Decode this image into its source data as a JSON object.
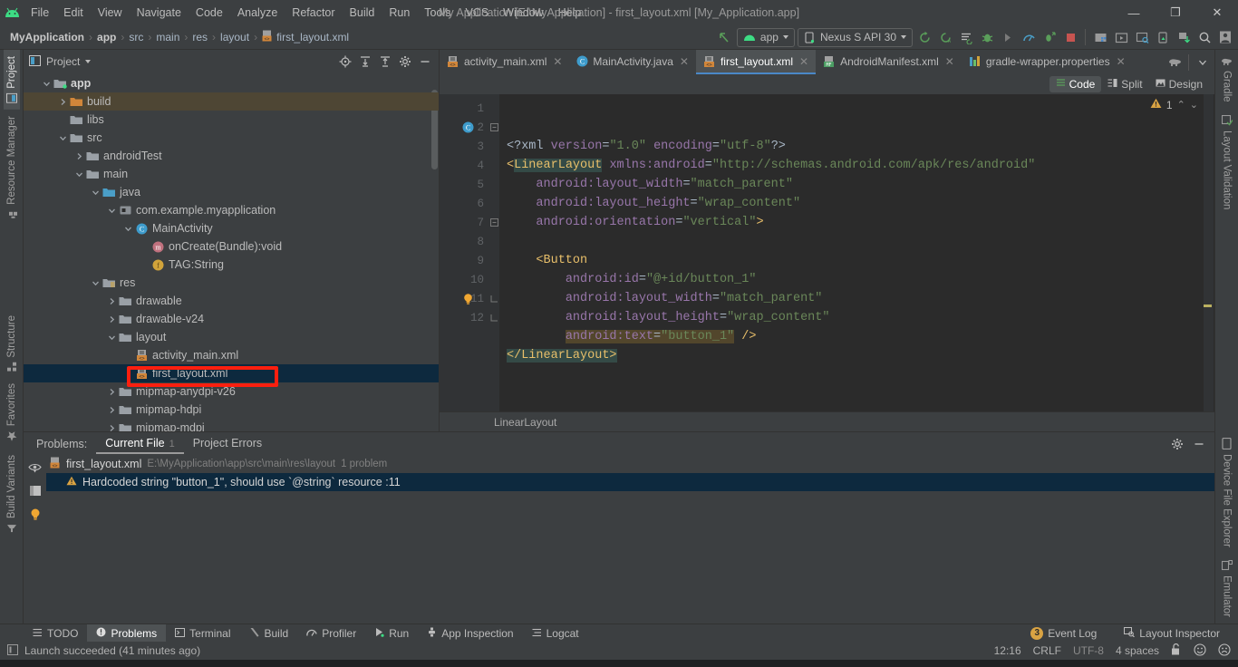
{
  "window": {
    "title": "My Application [E:\\MyApplication] - first_layout.xml [My_Application.app]",
    "minimize": "—",
    "maximize": "❐",
    "close": "✕"
  },
  "menu": {
    "items": [
      "File",
      "Edit",
      "View",
      "Navigate",
      "Code",
      "Analyze",
      "Refactor",
      "Build",
      "Run",
      "Tools",
      "VCS",
      "Window",
      "Help"
    ]
  },
  "breadcrumb": {
    "items": [
      "MyApplication",
      "app",
      "src",
      "main",
      "res",
      "layout"
    ],
    "file": "first_layout.xml",
    "separator": "›"
  },
  "toolbar": {
    "run_config": "app",
    "device": "Nexus S API 30",
    "icons": [
      "back-arrow-icon",
      "sync-project-icon",
      "avd-manager-icon",
      "sdk-manager-icon",
      "debug-icon",
      "run-step-icon",
      "profiler-icon",
      "attach-debugger-icon",
      "stop-icon",
      "project-structure-icon",
      "run-icon",
      "layout-inspector-icon",
      "device-manager-icon",
      "download-icon",
      "search-icon",
      "account-icon"
    ]
  },
  "left_rail": {
    "items": [
      {
        "label": "Project",
        "icon": "project-icon",
        "active": true
      },
      {
        "label": "Resource Manager",
        "icon": "resource-manager-icon",
        "active": false
      },
      {
        "label": "Structure",
        "icon": "structure-icon",
        "active": false
      },
      {
        "label": "Favorites",
        "icon": "star-icon",
        "active": false
      },
      {
        "label": "Build Variants",
        "icon": "build-variants-icon",
        "active": false
      }
    ]
  },
  "right_rail": {
    "top": [
      {
        "label": "Gradle",
        "icon": "gradle-elephant-icon"
      },
      {
        "label": "Layout Validation",
        "icon": "layout-validation-icon"
      }
    ],
    "bottom": [
      {
        "label": "Device File Explorer",
        "icon": "device-file-explorer-icon"
      },
      {
        "label": "Emulator",
        "icon": "emulator-icon"
      }
    ]
  },
  "project_panel": {
    "title": "Project",
    "header_icons": [
      "locate-icon",
      "expand-all-icon",
      "collapse-all-icon",
      "settings-gear-icon",
      "hide-icon"
    ],
    "tree": [
      {
        "label": "app",
        "depth": 1,
        "arrow": "down",
        "icon": "module-folder-icon",
        "bold": true,
        "state": "normal"
      },
      {
        "label": "build",
        "depth": 2,
        "arrow": "right",
        "icon": "folder-orange-icon",
        "bold": false,
        "state": "highlight"
      },
      {
        "label": "libs",
        "depth": 2,
        "arrow": "none",
        "icon": "folder-gray-icon",
        "bold": false,
        "state": "normal"
      },
      {
        "label": "src",
        "depth": 2,
        "arrow": "down",
        "icon": "folder-gray-icon",
        "bold": false,
        "state": "normal"
      },
      {
        "label": "androidTest",
        "depth": 3,
        "arrow": "right",
        "icon": "folder-gray-icon",
        "bold": false,
        "state": "normal"
      },
      {
        "label": "main",
        "depth": 3,
        "arrow": "down",
        "icon": "folder-gray-icon",
        "bold": false,
        "state": "normal"
      },
      {
        "label": "java",
        "depth": 4,
        "arrow": "down",
        "icon": "folder-blue-icon",
        "bold": false,
        "state": "normal"
      },
      {
        "label": "com.example.myapplication",
        "depth": 5,
        "arrow": "down",
        "icon": "package-icon",
        "bold": false,
        "state": "normal"
      },
      {
        "label": "MainActivity",
        "depth": 6,
        "arrow": "down",
        "icon": "class-icon",
        "bold": false,
        "state": "normal"
      },
      {
        "label": "onCreate(Bundle):void",
        "depth": 7,
        "arrow": "none",
        "icon": "method-icon",
        "bold": false,
        "state": "normal"
      },
      {
        "label": "TAG:String",
        "depth": 7,
        "arrow": "none",
        "icon": "field-icon",
        "bold": false,
        "state": "normal"
      },
      {
        "label": "res",
        "depth": 4,
        "arrow": "down",
        "icon": "res-folder-icon",
        "bold": false,
        "state": "normal"
      },
      {
        "label": "drawable",
        "depth": 5,
        "arrow": "right",
        "icon": "folder-gray-icon",
        "bold": false,
        "state": "normal"
      },
      {
        "label": "drawable-v24",
        "depth": 5,
        "arrow": "right",
        "icon": "folder-gray-icon",
        "bold": false,
        "state": "normal"
      },
      {
        "label": "layout",
        "depth": 5,
        "arrow": "down",
        "icon": "folder-gray-icon",
        "bold": false,
        "state": "normal"
      },
      {
        "label": "activity_main.xml",
        "depth": 6,
        "arrow": "none",
        "icon": "layout-xml-icon",
        "bold": false,
        "state": "normal"
      },
      {
        "label": "first_layout.xml",
        "depth": 6,
        "arrow": "none",
        "icon": "layout-xml-icon",
        "bold": false,
        "state": "selected"
      },
      {
        "label": "mipmap-anydpi-v26",
        "depth": 5,
        "arrow": "right",
        "icon": "folder-gray-icon",
        "bold": false,
        "state": "normal"
      },
      {
        "label": "mipmap-hdpi",
        "depth": 5,
        "arrow": "right",
        "icon": "folder-gray-icon",
        "bold": false,
        "state": "normal"
      },
      {
        "label": "mipmap-mdpi",
        "depth": 5,
        "arrow": "right",
        "icon": "folder-gray-icon",
        "bold": false,
        "state": "normal"
      }
    ]
  },
  "editor": {
    "tabs": [
      {
        "label": "activity_main.xml",
        "icon": "layout-xml-icon",
        "active": false
      },
      {
        "label": "MainActivity.java",
        "icon": "class-icon",
        "active": false
      },
      {
        "label": "first_layout.xml",
        "icon": "layout-xml-icon",
        "active": true
      },
      {
        "label": "AndroidManifest.xml",
        "icon": "manifest-icon",
        "active": false
      },
      {
        "label": "gradle-wrapper.properties",
        "icon": "properties-icon",
        "active": false
      }
    ],
    "tab_close": "✕",
    "view_modes": [
      {
        "label": "Code",
        "icon": "code-view-icon",
        "active": true
      },
      {
        "label": "Split",
        "icon": "split-view-icon",
        "active": false
      },
      {
        "label": "Design",
        "icon": "design-view-icon",
        "active": false
      }
    ],
    "warning_count": "1",
    "warning_icon": "warning-triangle-icon",
    "nav_up": "⌃",
    "nav_down": "⌄",
    "breadcrumb": "LinearLayout",
    "line_numbers": [
      "1",
      "2",
      "3",
      "4",
      "5",
      "6",
      "7",
      "8",
      "9",
      "10",
      "11",
      "12"
    ],
    "code_lines": [
      {
        "n": 1,
        "segments": [
          {
            "t": "<?xml ",
            "c": "k-proc"
          },
          {
            "t": "version",
            "c": "k-attr"
          },
          {
            "t": "=",
            "c": "k-eq"
          },
          {
            "t": "\"1.0\"",
            "c": "k-str"
          },
          {
            "t": " ",
            "c": "k-eq"
          },
          {
            "t": "encoding",
            "c": "k-attr"
          },
          {
            "t": "=",
            "c": "k-eq"
          },
          {
            "t": "\"utf-8\"",
            "c": "k-str"
          },
          {
            "t": "?>",
            "c": "k-proc"
          }
        ]
      },
      {
        "n": 2,
        "segments": [
          {
            "t": "<",
            "c": "k-tag"
          },
          {
            "t": "LinearLayout",
            "c": "k-tagsel"
          },
          {
            "t": " ",
            "c": "k-eq"
          },
          {
            "t": "xmlns:android",
            "c": "k-attr"
          },
          {
            "t": "=",
            "c": "k-eq"
          },
          {
            "t": "\"http://schemas.android.com/apk/res/android\"",
            "c": "k-str"
          }
        ]
      },
      {
        "n": 3,
        "segments": [
          {
            "t": "    ",
            "c": "k-eq"
          },
          {
            "t": "android:layout_width",
            "c": "k-attr"
          },
          {
            "t": "=",
            "c": "k-eq"
          },
          {
            "t": "\"match_parent\"",
            "c": "k-str"
          }
        ]
      },
      {
        "n": 4,
        "segments": [
          {
            "t": "    ",
            "c": "k-eq"
          },
          {
            "t": "android:layout_height",
            "c": "k-attr"
          },
          {
            "t": "=",
            "c": "k-eq"
          },
          {
            "t": "\"wrap_content\"",
            "c": "k-str"
          }
        ]
      },
      {
        "n": 5,
        "segments": [
          {
            "t": "    ",
            "c": "k-eq"
          },
          {
            "t": "android:orientation",
            "c": "k-attr"
          },
          {
            "t": "=",
            "c": "k-eq"
          },
          {
            "t": "\"vertical\"",
            "c": "k-str"
          },
          {
            "t": ">",
            "c": "k-tag"
          }
        ]
      },
      {
        "n": 6,
        "segments": []
      },
      {
        "n": 7,
        "segments": [
          {
            "t": "    ",
            "c": "k-eq"
          },
          {
            "t": "<Button",
            "c": "k-tag"
          }
        ]
      },
      {
        "n": 8,
        "segments": [
          {
            "t": "        ",
            "c": "k-eq"
          },
          {
            "t": "android:id",
            "c": "k-attr"
          },
          {
            "t": "=",
            "c": "k-eq"
          },
          {
            "t": "\"@+id/button_1\"",
            "c": "k-str"
          }
        ]
      },
      {
        "n": 9,
        "segments": [
          {
            "t": "        ",
            "c": "k-eq"
          },
          {
            "t": "android:layout_width",
            "c": "k-attr"
          },
          {
            "t": "=",
            "c": "k-eq"
          },
          {
            "t": "\"match_parent\"",
            "c": "k-str"
          }
        ]
      },
      {
        "n": 10,
        "segments": [
          {
            "t": "        ",
            "c": "k-eq"
          },
          {
            "t": "android:layout_height",
            "c": "k-attr"
          },
          {
            "t": "=",
            "c": "k-eq"
          },
          {
            "t": "\"wrap_content\"",
            "c": "k-str"
          }
        ]
      },
      {
        "n": 11,
        "segments": [
          {
            "t": "        ",
            "c": "k-eq"
          },
          {
            "t": "android:text",
            "c": "k-attr k-warn-bg"
          },
          {
            "t": "=",
            "c": "k-eq k-warn-bg"
          },
          {
            "t": "\"button_1\"",
            "c": "k-str k-warn-bg"
          },
          {
            "t": " ",
            "c": "k-eq"
          },
          {
            "t": "/>",
            "c": "k-tag"
          }
        ]
      },
      {
        "n": 12,
        "segments": [
          {
            "t": "</LinearLayout>",
            "c": "k-tagsel"
          }
        ]
      }
    ]
  },
  "problems": {
    "label": "Problems:",
    "tabs": [
      {
        "label": "Current File",
        "count": "1",
        "active": true
      },
      {
        "label": "Project Errors",
        "count": "",
        "active": false
      }
    ],
    "header_icons": [
      "settings-gear-icon",
      "hide-panel-icon"
    ],
    "gutter_icons": [
      "eye-icon",
      "panel-icon",
      "lightbulb-icon"
    ],
    "file_row": {
      "icon": "layout-xml-icon",
      "name": "first_layout.xml",
      "path": "E:\\MyApplication\\app\\src\\main\\res\\layout",
      "count": "1 problem"
    },
    "items": [
      {
        "icon": "warning-triangle-icon",
        "text": "Hardcoded string \"button_1\", should use `@string` resource :11"
      }
    ]
  },
  "toolwindow_bar": {
    "items": [
      {
        "label": "TODO",
        "icon": "todo-icon",
        "active": false
      },
      {
        "label": "Problems",
        "icon": "problems-icon",
        "active": true
      },
      {
        "label": "Terminal",
        "icon": "terminal-icon",
        "active": false
      },
      {
        "label": "Build",
        "icon": "build-hammer-icon",
        "active": false
      },
      {
        "label": "Profiler",
        "icon": "profiler-icon",
        "active": false
      },
      {
        "label": "Run",
        "icon": "run-play-icon",
        "active": false
      },
      {
        "label": "App Inspection",
        "icon": "app-inspection-icon",
        "active": false
      },
      {
        "label": "Logcat",
        "icon": "logcat-icon",
        "active": false
      }
    ],
    "right": [
      {
        "label": "Event Log",
        "badge": "3",
        "icon": "event-log-icon"
      },
      {
        "label": "Layout Inspector",
        "badge": "",
        "icon": "layout-inspector-icon"
      }
    ]
  },
  "statusbar": {
    "message": "Launch succeeded (41 minutes ago)",
    "message_icon": "console-icon",
    "time": "12:16",
    "line_sep": "CRLF",
    "encoding": "UTF-8",
    "indent": "4 spaces",
    "lock_icon": "unlocked-padlock-icon",
    "faces": [
      "smiley-face-icon",
      "frowny-face-icon"
    ]
  },
  "colors": {
    "accent_blue": "#4a88c7",
    "selection_blue": "#0d293e",
    "annotation_red": "#fb1f0f",
    "warning_yellow": "#d9a343",
    "panel_bg": "#3c3f41",
    "editor_bg": "#2b2b2b",
    "android_green": "#3ddc84"
  }
}
